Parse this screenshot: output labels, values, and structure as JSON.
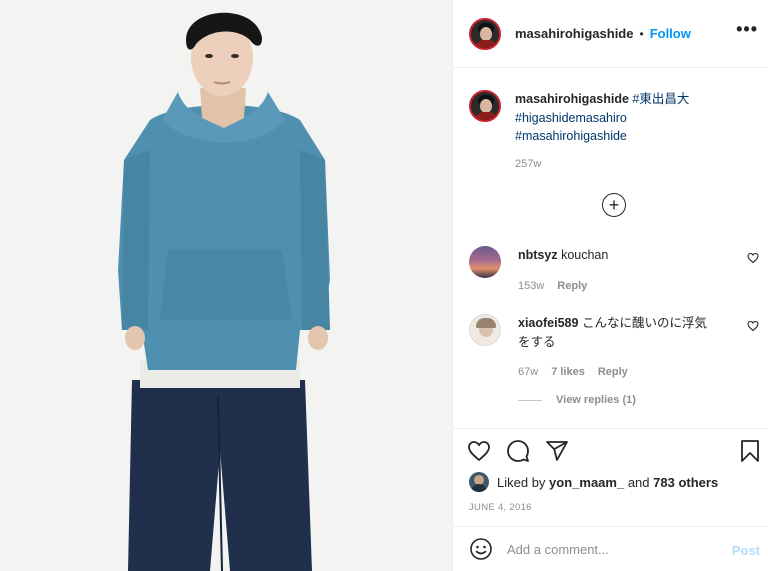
{
  "post": {
    "author": "masahirohigashide",
    "follow_label": "Follow",
    "separator": "•",
    "more_icon": "more-options-icon",
    "more_label": "•••"
  },
  "caption": {
    "username": "masahirohigashide",
    "tags": [
      "#東出昌大",
      "#higashidemasahiro",
      "#masahirohigashide"
    ],
    "time": "257w"
  },
  "load_more_label": "+",
  "comments": [
    {
      "username": "nbtsyz",
      "text": "kouchan",
      "time": "153w",
      "likes": "",
      "reply": "Reply"
    },
    {
      "username": "xiaofei589",
      "text": "こんなに醜いのに浮気をする",
      "time": "67w",
      "likes": "7 likes",
      "reply": "Reply"
    }
  ],
  "view_replies": "View replies (1)",
  "likes": {
    "prefix": "Liked by",
    "user": "yon_maam_",
    "middle": "and",
    "count": "783 others"
  },
  "date": "JUNE 4, 2016",
  "composer": {
    "placeholder": "Add a comment...",
    "post_label": "Post"
  },
  "colors": {
    "accent": "#0095f6",
    "post_disabled": "#b2dffc",
    "hoodie": "#4f8fb0",
    "pants": "#1f2f4c"
  }
}
